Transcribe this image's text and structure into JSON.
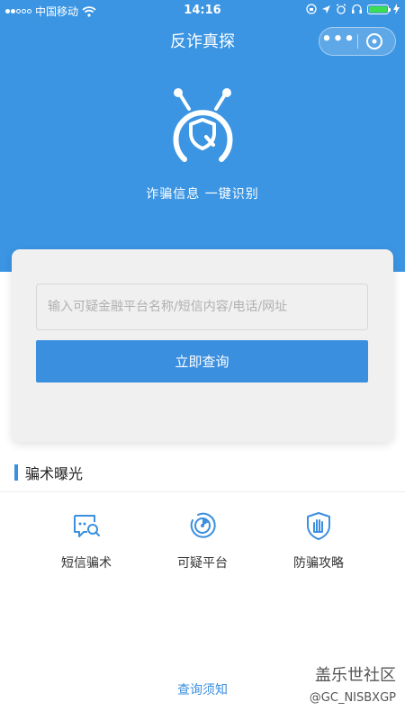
{
  "status_bar": {
    "carrier": "中国移动",
    "time": "14:16",
    "battery_color": "#3ddc56"
  },
  "nav": {
    "title": "反诈真探",
    "more_icon": "more-icon",
    "close_icon": "close-circle-icon"
  },
  "hero": {
    "logo_icon": "shield-magnifier-logo",
    "slogan": "诈骗信息 一键识别"
  },
  "search": {
    "placeholder": "输入可疑金融平台名称/短信内容/电话/网址",
    "value": "",
    "button_label": "立即查询"
  },
  "section": {
    "title": "骗术曝光"
  },
  "categories": [
    {
      "label": "短信骗术",
      "icon": "sms-search-icon"
    },
    {
      "label": "可疑平台",
      "icon": "radar-icon"
    },
    {
      "label": "防骗攻略",
      "icon": "hand-shield-icon"
    }
  ],
  "footer": {
    "link_label": "查询须知"
  },
  "watermark": {
    "title": "盖乐世社区",
    "id": "@GC_NISBXGP"
  },
  "colors": {
    "primary": "#3b95e3",
    "button": "#3b8fdf",
    "card_bg": "#f0f0f0"
  }
}
